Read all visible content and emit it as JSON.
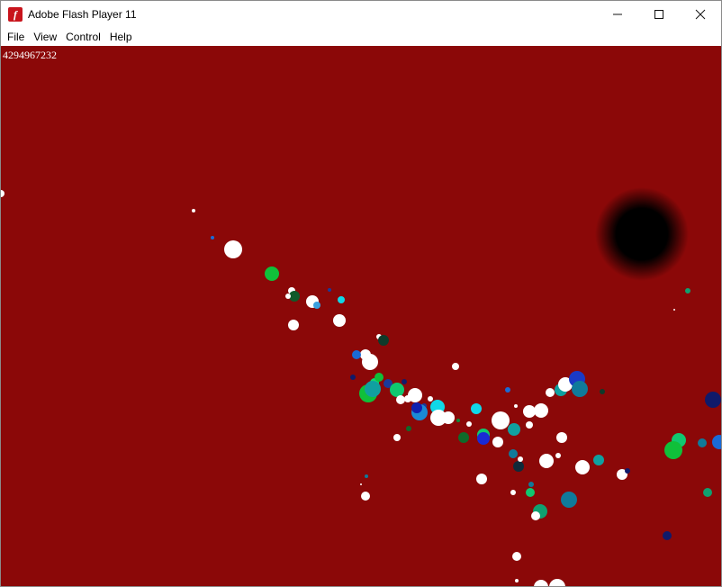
{
  "window": {
    "title": "Adobe Flash Player 11",
    "icon": "flash-player-icon",
    "controls": [
      "minimize-icon",
      "maximize-icon",
      "close-icon"
    ]
  },
  "menu": [
    "File",
    "View",
    "Control",
    "Help"
  ],
  "stage": {
    "background": "#8b0808",
    "counter": "4294967232"
  }
}
